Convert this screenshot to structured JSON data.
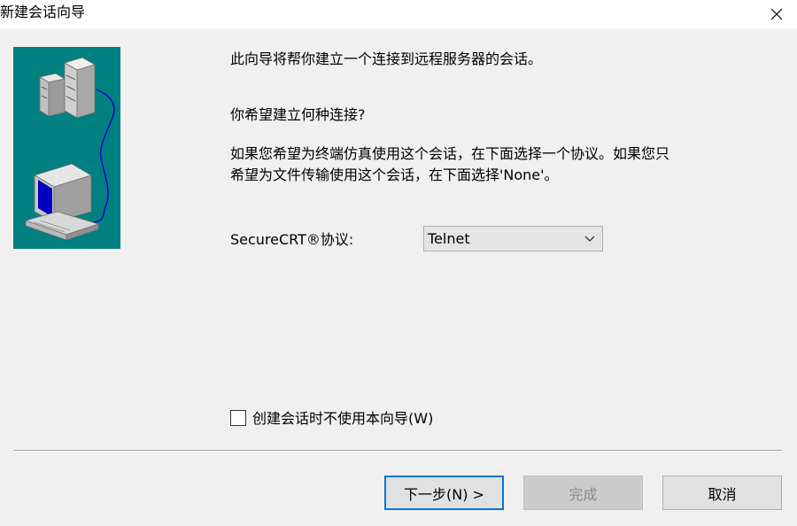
{
  "window": {
    "title": "新建会话向导"
  },
  "wizard": {
    "intro": "此向导将帮你建立一个连接到远程服务器的会话。",
    "question": "你希望建立何种连接?",
    "description_line1": "如果您希望为终端仿真使用这个会话，在下面选择一个协议。如果您只",
    "description_line2": "希望为文件传输使用这个会话，在下面选择'None'。",
    "protocol_label": "SecureCRT®协议:",
    "protocol_value": "Telnet",
    "skip_wizard_checkbox": {
      "label": "创建会话时不使用本向导(W)",
      "checked": false
    }
  },
  "buttons": {
    "next": "下一步(N) >",
    "finish": "完成",
    "cancel": "取消"
  },
  "colors": {
    "illustration_bg": "#008080",
    "focus_border": "#0078d7",
    "cable": "#0000cc",
    "screen": "#0000c0"
  },
  "icons": [
    "close-icon",
    "server-icon",
    "computer-icon",
    "chevron-down-icon"
  ]
}
